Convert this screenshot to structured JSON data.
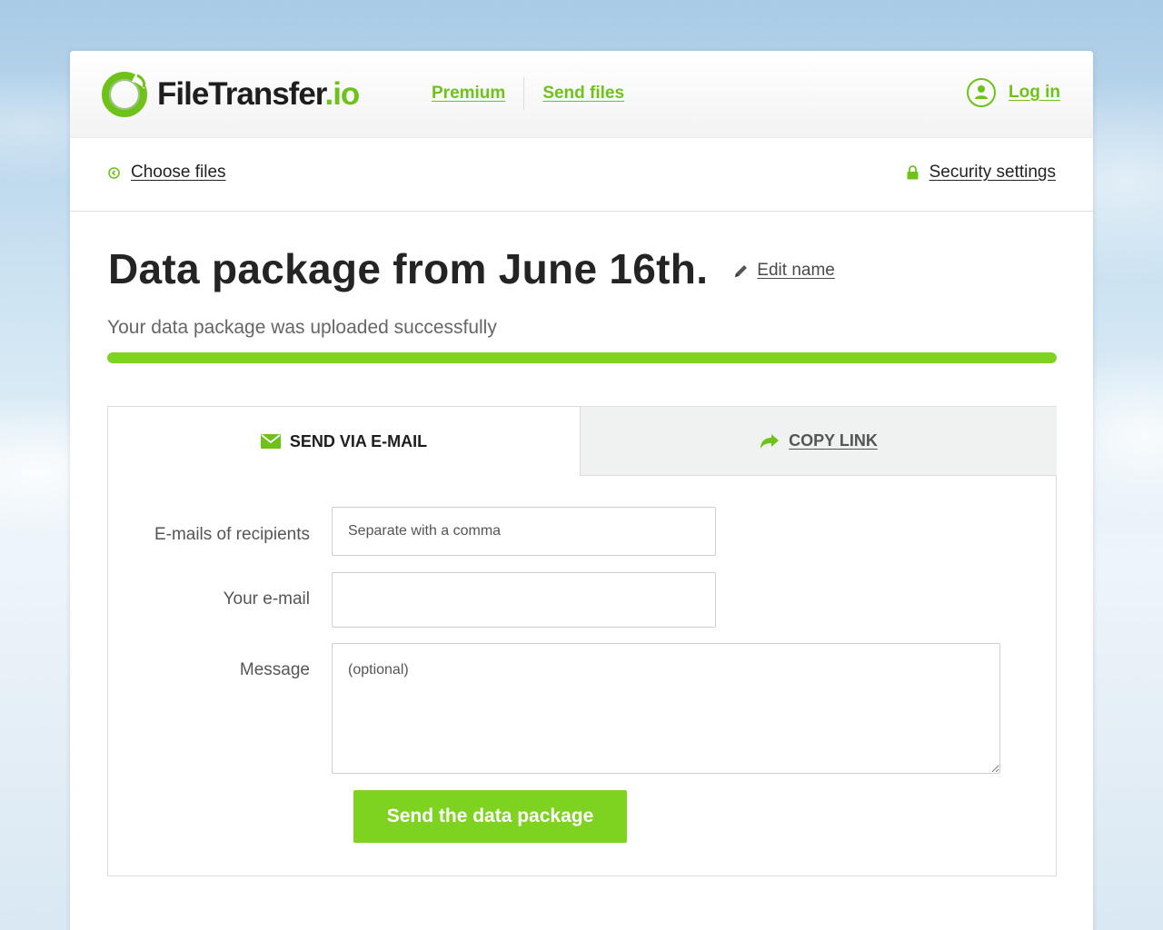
{
  "brand": {
    "name_main": "FileTransfer",
    "name_suffix": ".io",
    "accent": "#6fc21a"
  },
  "nav": {
    "items": [
      {
        "label": "Premium"
      },
      {
        "label": "Send files"
      }
    ],
    "login_label": "Log in"
  },
  "subbar": {
    "choose_files": "Choose files",
    "security_settings": "Security settings"
  },
  "package": {
    "title": "Data package from June 16th.",
    "edit_label": "Edit name",
    "status_text": "Your data package was uploaded successfully",
    "upload_progress_percent": 100
  },
  "tabs": {
    "email_label": "SEND VIA E-MAIL",
    "link_label": "COPY LINK",
    "active": "email"
  },
  "form": {
    "recipients": {
      "label": "E-mails of recipients",
      "placeholder": "Separate with a comma",
      "value": ""
    },
    "your_email": {
      "label": "Your e-mail",
      "placeholder": "",
      "value": ""
    },
    "message": {
      "label": "Message",
      "placeholder": "(optional)",
      "value": ""
    },
    "submit_label": "Send the data package"
  },
  "icons": {
    "logo": "logo-ring-icon",
    "login": "user-circle-icon",
    "choose": "arrow-left-circle-icon",
    "security": "lock-icon",
    "edit": "pencil-icon",
    "email": "envelope-icon",
    "link": "share-arrow-icon"
  }
}
